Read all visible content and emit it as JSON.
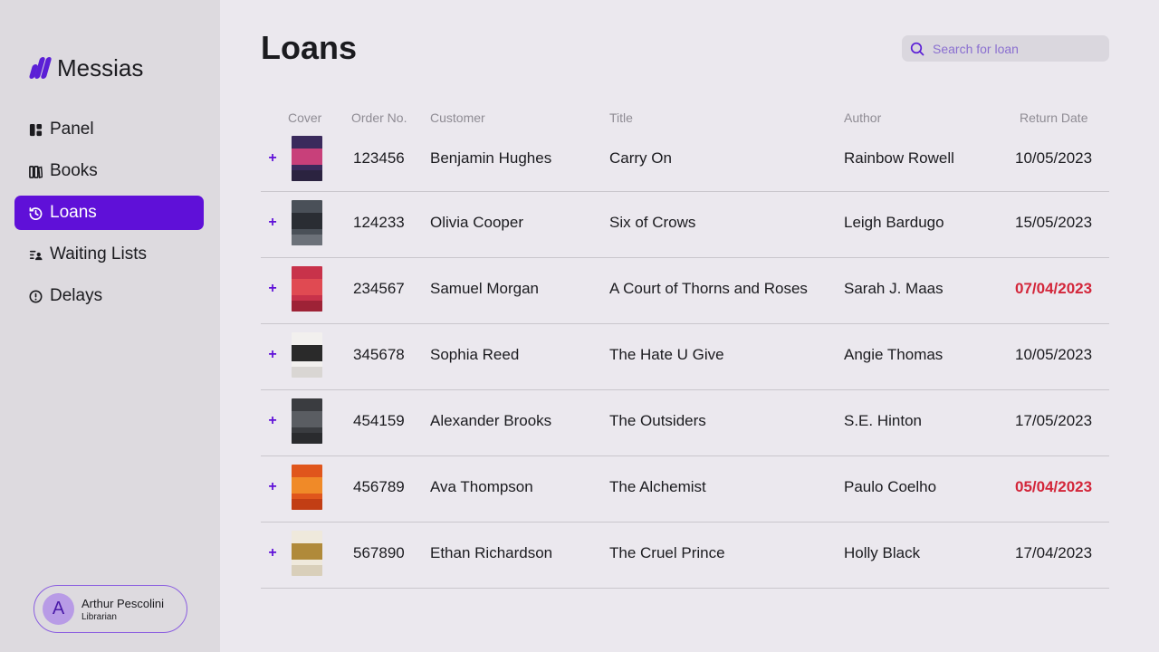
{
  "app": {
    "name": "Messias"
  },
  "sidebar": {
    "items": [
      {
        "label": "Panel",
        "icon": "panel-icon",
        "active": false
      },
      {
        "label": "Books",
        "icon": "books-icon",
        "active": false
      },
      {
        "label": "Loans",
        "icon": "loans-icon",
        "active": true
      },
      {
        "label": "Waiting Lists",
        "icon": "waiting-list-icon",
        "active": false
      },
      {
        "label": "Delays",
        "icon": "delays-icon",
        "active": false
      }
    ],
    "user": {
      "initial": "A",
      "name": "Arthur Pescolini",
      "role": "Librarian"
    }
  },
  "page": {
    "title": "Loans"
  },
  "search": {
    "placeholder": "Search for loan",
    "value": ""
  },
  "table": {
    "headers": {
      "cover": "Cover",
      "order": "Order No.",
      "customer": "Customer",
      "title": "Title",
      "author": "Author",
      "return_date": "Return Date"
    },
    "rows": [
      {
        "order": "123456",
        "customer": "Benjamin Hughes",
        "title": "Carry On",
        "author": "Rainbow Rowell",
        "return_date": "10/05/2023",
        "overdue": false,
        "cover_colors": [
          "#3a2a5c",
          "#c8407a",
          "#2b2340"
        ]
      },
      {
        "order": "124233",
        "customer": "Olivia Cooper",
        "title": "Six of Crows",
        "author": "Leigh Bardugo",
        "return_date": "15/05/2023",
        "overdue": false,
        "cover_colors": [
          "#4a5058",
          "#2a2d33",
          "#6c7179"
        ]
      },
      {
        "order": "234567",
        "customer": "Samuel Morgan",
        "title": "A Court of Thorns and Roses",
        "author": "Sarah J. Maas",
        "return_date": "07/04/2023",
        "overdue": true,
        "cover_colors": [
          "#c8324a",
          "#e04a52",
          "#9e2236"
        ]
      },
      {
        "order": "345678",
        "customer": "Sophia Reed",
        "title": "The Hate U Give",
        "author": "Angie Thomas",
        "return_date": "10/05/2023",
        "overdue": false,
        "cover_colors": [
          "#f2f0ee",
          "#2a2a2a",
          "#d9d6d3"
        ]
      },
      {
        "order": "454159",
        "customer": "Alexander Brooks",
        "title": "The Outsiders",
        "author": "S.E. Hinton",
        "return_date": "17/05/2023",
        "overdue": false,
        "cover_colors": [
          "#3a3c40",
          "#5a5d62",
          "#2a2b2e"
        ]
      },
      {
        "order": "456789",
        "customer": "Ava Thompson",
        "title": "The Alchemist",
        "author": "Paulo Coelho",
        "return_date": "05/04/2023",
        "overdue": true,
        "cover_colors": [
          "#e0561c",
          "#f08a28",
          "#c23e14"
        ]
      },
      {
        "order": "567890",
        "customer": "Ethan Richardson",
        "title": "The Cruel Prince",
        "author": "Holly Black",
        "return_date": "17/04/2023",
        "overdue": false,
        "cover_colors": [
          "#efe9dc",
          "#b08a3a",
          "#d9cfba"
        ]
      }
    ]
  },
  "colors": {
    "accent": "#5f10d8",
    "overdue": "#d3263a",
    "sidebar_bg": "#dddadf",
    "page_bg": "#ebe8ee"
  }
}
